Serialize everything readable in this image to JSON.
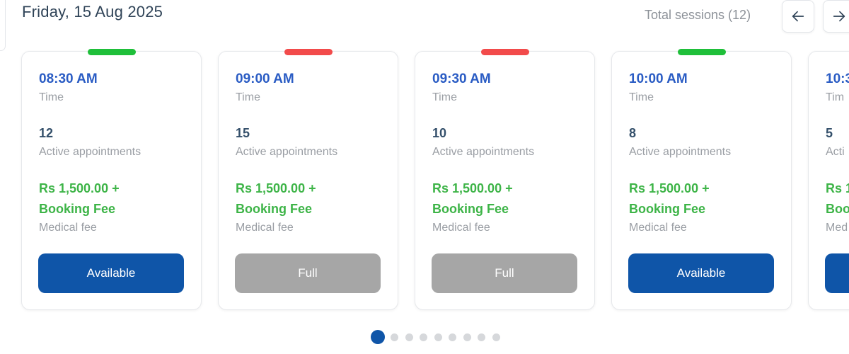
{
  "header": {
    "date": "Friday, 15 Aug 2025",
    "total_sessions": "Total sessions (12)",
    "prev_icon": "arrow-left-icon",
    "next_icon": "arrow-right-icon"
  },
  "colors": {
    "available_bar": "#1fbf3a",
    "full_bar": "#f24b4b",
    "available_button": "#0f55a8",
    "full_button": "#a6a6a6",
    "time_text": "#2a5cc4",
    "fee_text": "#3db447",
    "active_dot": "#0f55a8",
    "inactive_dot": "#d6d8db"
  },
  "sessions": [
    {
      "time": "08:30 AM",
      "time_label": "Time",
      "appointments": "12",
      "appointments_label": "Active appointments",
      "fee_amount": "Rs 1,500.00 +",
      "fee_extra": "Booking Fee",
      "fee_label": "Medical fee",
      "status": "available",
      "button_label": "Available"
    },
    {
      "time": "09:00 AM",
      "time_label": "Time",
      "appointments": "15",
      "appointments_label": "Active appointments",
      "fee_amount": "Rs 1,500.00 +",
      "fee_extra": "Booking Fee",
      "fee_label": "Medical fee",
      "status": "full",
      "button_label": "Full"
    },
    {
      "time": "09:30 AM",
      "time_label": "Time",
      "appointments": "10",
      "appointments_label": "Active appointments",
      "fee_amount": "Rs 1,500.00 +",
      "fee_extra": "Booking Fee",
      "fee_label": "Medical fee",
      "status": "full",
      "button_label": "Full"
    },
    {
      "time": "10:00 AM",
      "time_label": "Time",
      "appointments": "8",
      "appointments_label": "Active appointments",
      "fee_amount": "Rs 1,500.00 +",
      "fee_extra": "Booking Fee",
      "fee_label": "Medical fee",
      "status": "available",
      "button_label": "Available"
    },
    {
      "time": "10:3",
      "time_label": "Tim",
      "appointments": "5",
      "appointments_label": "Acti",
      "fee_amount": "Rs 1",
      "fee_extra": "Boo",
      "fee_label": "Med",
      "status": "available",
      "button_label": ""
    }
  ],
  "pagination": {
    "total_dots": 9,
    "active_index": 0
  }
}
